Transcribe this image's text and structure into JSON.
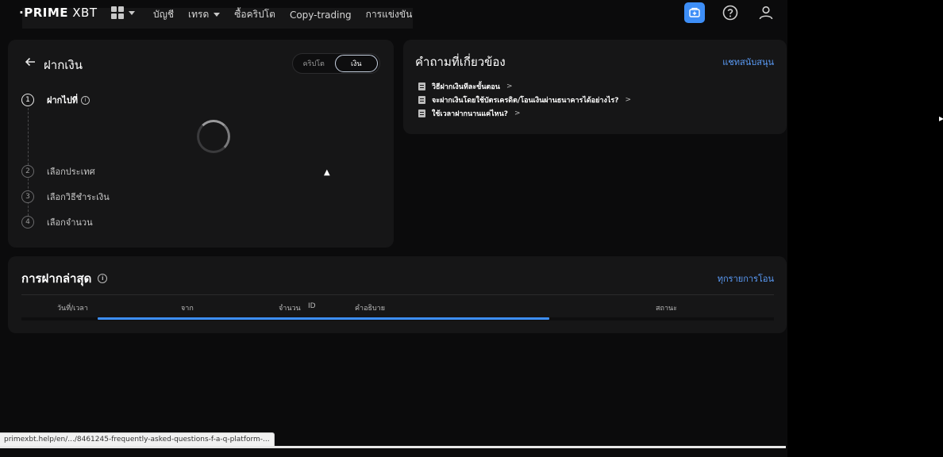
{
  "topbar": {
    "logo_main": "·PRIME",
    "logo_second": " XBT",
    "nav": [
      "บัญชี",
      "เทรด",
      "ซื้อคริปโต",
      "Copy-trading",
      "การแข่งขัน"
    ]
  },
  "deposit": {
    "title": "ฝากเงิน",
    "toggle": [
      "คริปโต",
      "เงิน"
    ],
    "steps": [
      {
        "num": "1",
        "label": "ฝากไปที่"
      },
      {
        "num": "2",
        "label": "เลือกประเทศ"
      },
      {
        "num": "3",
        "label": "เลือกวิธีชำระเงิน"
      },
      {
        "num": "4",
        "label": "เลือกจำนวน"
      }
    ]
  },
  "faq": {
    "title": "คำถามที่เกี่ยวข้อง",
    "support_link": "แชทสนับสนุน",
    "items": [
      "วิธีฝากเงินทีละขั้นตอน",
      "จะฝากเงินโดยใช้บัตรเครดิต/โอนเงินผ่านธนาคารได้อย่างไร?",
      "ใช้เวลาฝากนานแค่ไหน?"
    ]
  },
  "recent": {
    "title": "การฝากล่าสุด",
    "all_link": "ทุกรายการโอน",
    "columns": [
      "วันที่/เวลา",
      "จาก",
      "จำนวน",
      "ID",
      "คำอธิบาย",
      "สถานะ"
    ],
    "scroll_fraction": 0.6
  },
  "status_url": "primexbt.help/en/.../8461245-frequently-asked-questions-f-a-q-platform-...",
  "colors": {
    "accent": "#3d8ef7",
    "link": "#5b9cf8",
    "panel": "#161617",
    "bg": "#0b0b0c"
  }
}
